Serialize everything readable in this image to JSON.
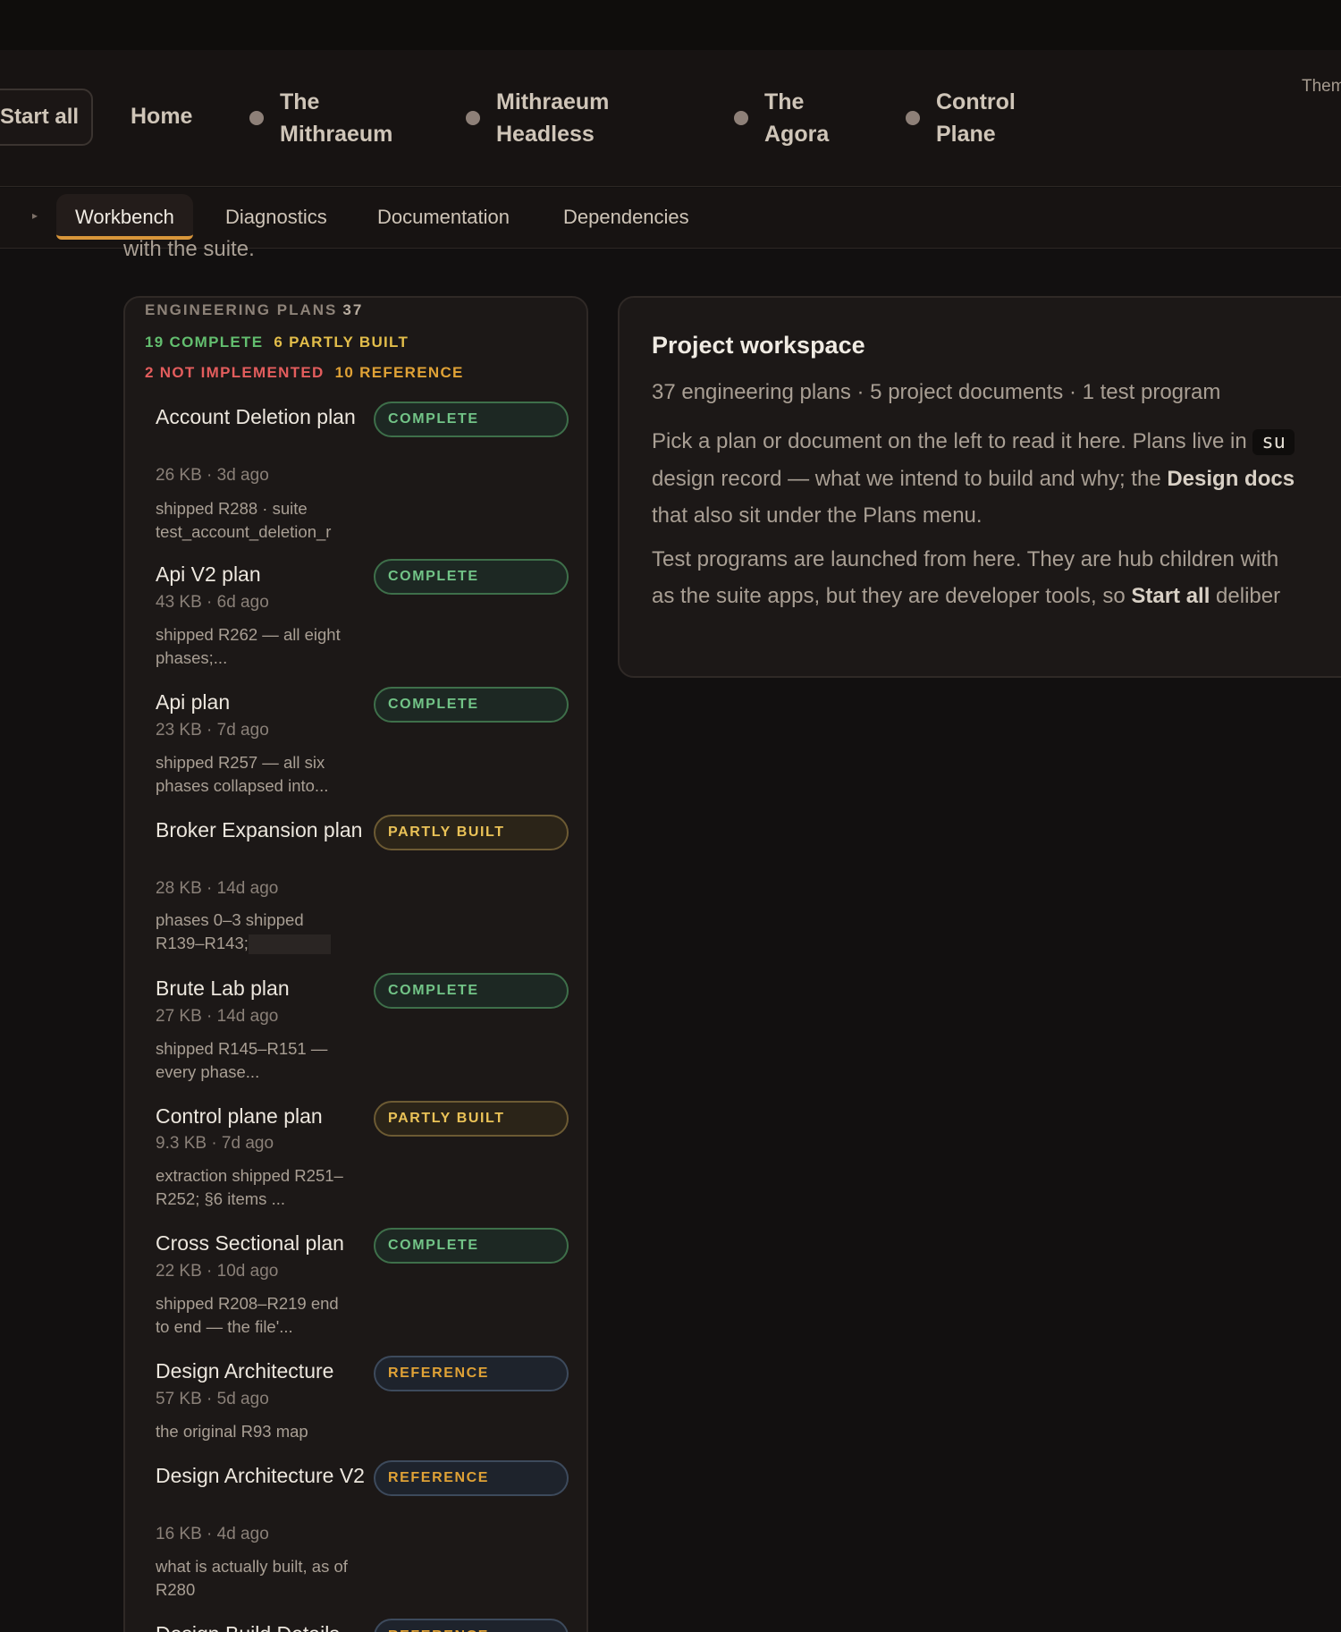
{
  "header": {
    "start_all": "Start all",
    "home": "Home",
    "nav_items": [
      {
        "line1": "The",
        "line2": "Mithraeum"
      },
      {
        "line1": "Mithraeum",
        "line2": "Headless"
      },
      {
        "line1": "The",
        "line2": "Agora"
      },
      {
        "line1": "Control",
        "line2": "Plane"
      }
    ],
    "theme_label": "Them"
  },
  "tabs": {
    "caret": "▸",
    "items": [
      "Workbench",
      "Diagnostics",
      "Documentation",
      "Dependencies"
    ],
    "active": "Workbench",
    "accent_color": "#d9963a"
  },
  "intro_clip": "with the suite.",
  "plans": {
    "heading": "ENGINEERING PLANS",
    "count": "37",
    "complete": "19 COMPLETE",
    "partly": "6 PARTLY BUILT",
    "not_impl": "2 NOT IMPLEMENTED",
    "reference": "10 REFERENCE",
    "items": [
      {
        "title": "Account Deletion plan",
        "badge": "COMPLETE",
        "meta": "26 KB · 3d ago",
        "desc": "shipped R288 · suite test_account_deletion_r"
      },
      {
        "title": "Api V2 plan",
        "badge": "COMPLETE",
        "meta": "43 KB · 6d ago",
        "desc": "shipped R262 — all eight phases;..."
      },
      {
        "title": "Api plan",
        "badge": "COMPLETE",
        "meta": "23 KB · 7d ago",
        "desc": "shipped R257 — all six phases collapsed into..."
      },
      {
        "title": "Broker Expansion plan",
        "badge": "PARTLY BUILT",
        "meta": "28 KB · 14d ago",
        "desc": "phases 0–3 shipped R139–R143;"
      },
      {
        "title": "Brute Lab plan",
        "badge": "COMPLETE",
        "meta": "27 KB · 14d ago",
        "desc": "shipped R145–R151 — every phase..."
      },
      {
        "title": "Control plane plan",
        "badge": "PARTLY BUILT",
        "meta": "9.3 KB · 7d ago",
        "desc": "extraction shipped R251–R252; §6 items ..."
      },
      {
        "title": "Cross Sectional plan",
        "badge": "COMPLETE",
        "meta": "22 KB · 10d ago",
        "desc": "shipped R208–R219 end to end — the file'..."
      },
      {
        "title": "Design Architecture",
        "badge": "REFERENCE",
        "meta": "57 KB · 5d ago",
        "desc": "the original R93 map"
      },
      {
        "title": "Design Architecture V2",
        "badge": "REFERENCE",
        "meta": "16 KB · 4d ago",
        "desc": "what is actually built, as of R280"
      },
      {
        "title": "Design Build Details",
        "badge": "REFERENCE",
        "meta": "",
        "desc": ""
      }
    ]
  },
  "workspace": {
    "title": "Project workspace",
    "summary": "37 engineering plans · 5 project documents · 1 test program",
    "p1_pre": "Pick a plan or document on the left to read it here. Plans live in",
    "p1_code": "su",
    "p1b_pre": "design record — what we intend to build and why; the",
    "p1b_bold": "Design docs",
    "p1c": "that also sit under the Plans menu.",
    "p2a": "Test programs are launched from here. They are hub children with",
    "p2b_pre": "as the suite apps, but they are developer tools, so",
    "p2b_bold": "Start all",
    "p2b_post": "deliber"
  }
}
